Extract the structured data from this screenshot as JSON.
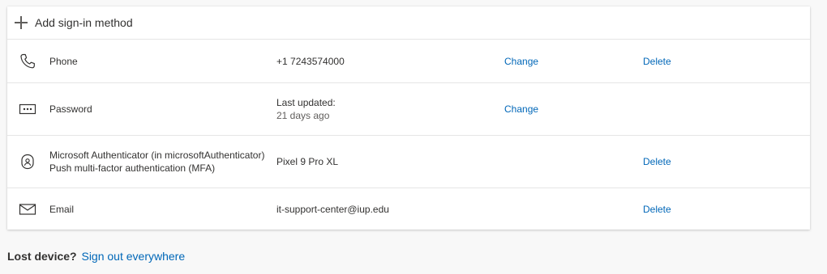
{
  "add_method": {
    "label": "Add sign-in method",
    "icon": "plus-icon"
  },
  "methods": [
    {
      "icon": "phone-icon",
      "name": "Phone",
      "detail": "+1 7243574000",
      "change": "Change",
      "delete": "Delete"
    },
    {
      "icon": "password-icon",
      "name": "Password",
      "detail_line1": "Last updated:",
      "detail_line2": "21 days ago",
      "change": "Change"
    },
    {
      "icon": "authenticator-icon",
      "name_line1": "Microsoft Authenticator (in microsoftAuthenticator)",
      "name_line2": "Push multi-factor authentication (MFA)",
      "detail": "Pixel 9 Pro XL",
      "delete": "Delete"
    },
    {
      "icon": "email-icon",
      "name": "Email",
      "detail": "it-support-center@iup.edu",
      "delete": "Delete"
    }
  ],
  "footer": {
    "question": "Lost device?",
    "link": "Sign out everywhere"
  },
  "colors": {
    "link": "#0067b8",
    "text": "#323130",
    "background": "#f8f8f8"
  }
}
